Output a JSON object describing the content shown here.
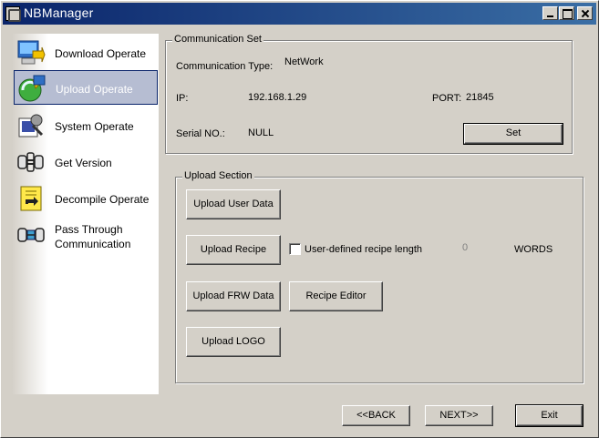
{
  "window": {
    "title": "NBManager"
  },
  "sidebar": {
    "items": [
      {
        "label": "Download Operate",
        "icon": "download-icon"
      },
      {
        "label": "Upload Operate",
        "icon": "upload-icon",
        "active": true
      },
      {
        "label": "System Operate",
        "icon": "system-icon"
      },
      {
        "label": "Get Version",
        "icon": "version-icon"
      },
      {
        "label": "Decompile Operate",
        "icon": "decompile-icon"
      },
      {
        "label": "Pass Through Communication",
        "icon": "pass-through-icon"
      }
    ]
  },
  "communication": {
    "legend": "Communication Set",
    "type_label": "Communication Type:",
    "type_value": "NetWork",
    "ip_label": "IP:",
    "ip_value": "192.168.1.29",
    "port_label": "PORT:",
    "port_value": "21845",
    "serial_label": "Serial NO.:",
    "serial_value": "NULL",
    "set_button": "Set"
  },
  "upload": {
    "legend": "Upload Section",
    "upload_user_data": "Upload User Data",
    "upload_recipe": "Upload Recipe",
    "recipe_length_checkbox": "User-defined recipe length",
    "recipe_length_value": "0",
    "recipe_length_unit": "WORDS",
    "upload_frw_data": "Upload FRW Data",
    "recipe_editor": "Recipe Editor",
    "upload_logo": "Upload LOGO"
  },
  "footer": {
    "back": "<<BACK",
    "next": "NEXT>>",
    "exit": "Exit"
  },
  "colors": {
    "titlebar_start": "#0a246a",
    "titlebar_end": "#3a6ea5",
    "face": "#d4d0c8",
    "active_item_bg": "#b6bdd2"
  }
}
